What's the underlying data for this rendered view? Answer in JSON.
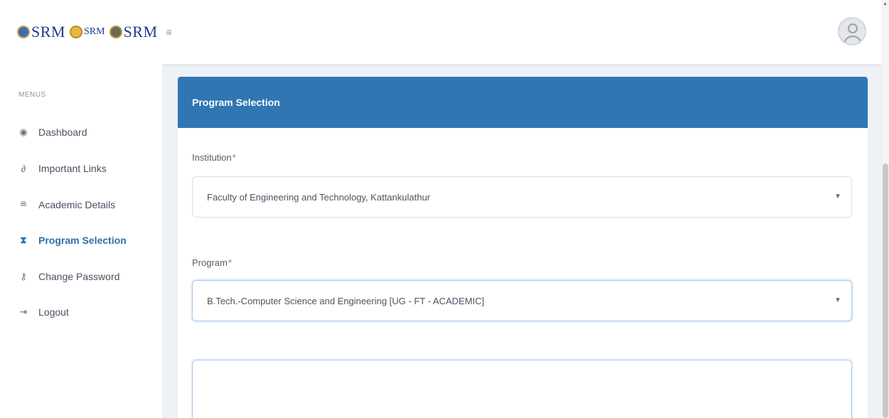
{
  "header": {
    "logos": [
      {
        "text": "SRM",
        "style": "blue"
      },
      {
        "text": "SRM",
        "style": "gold"
      },
      {
        "text": "SRM",
        "style": "dark"
      }
    ],
    "menu_icon": "hamburger-icon",
    "avatar_icon": "user-avatar-icon"
  },
  "sidebar": {
    "title": "MENUS",
    "items": [
      {
        "label": "Dashboard",
        "icon": "dashboard-icon",
        "active": false
      },
      {
        "label": "Important Links",
        "icon": "link-icon",
        "active": false
      },
      {
        "label": "Academic Details",
        "icon": "graduation-icon",
        "active": false
      },
      {
        "label": "Program Selection",
        "icon": "hourglass-icon",
        "active": true
      },
      {
        "label": "Change Password",
        "icon": "key-icon",
        "active": false
      },
      {
        "label": "Logout",
        "icon": "logout-icon",
        "active": false
      }
    ]
  },
  "card": {
    "title": "Program Selection",
    "institution": {
      "label": "Institution",
      "required_mark": "*",
      "value": "Faculty of Engineering and Technology, Kattankulathur"
    },
    "program": {
      "label": "Program",
      "required_mark": "*",
      "value": "B.Tech.-Computer Science and Engineering [UG - FT - ACADEMIC]"
    }
  },
  "colors": {
    "accent": "#2f76b3",
    "active_nav": "#2c6fae",
    "required": "#e0533d"
  }
}
